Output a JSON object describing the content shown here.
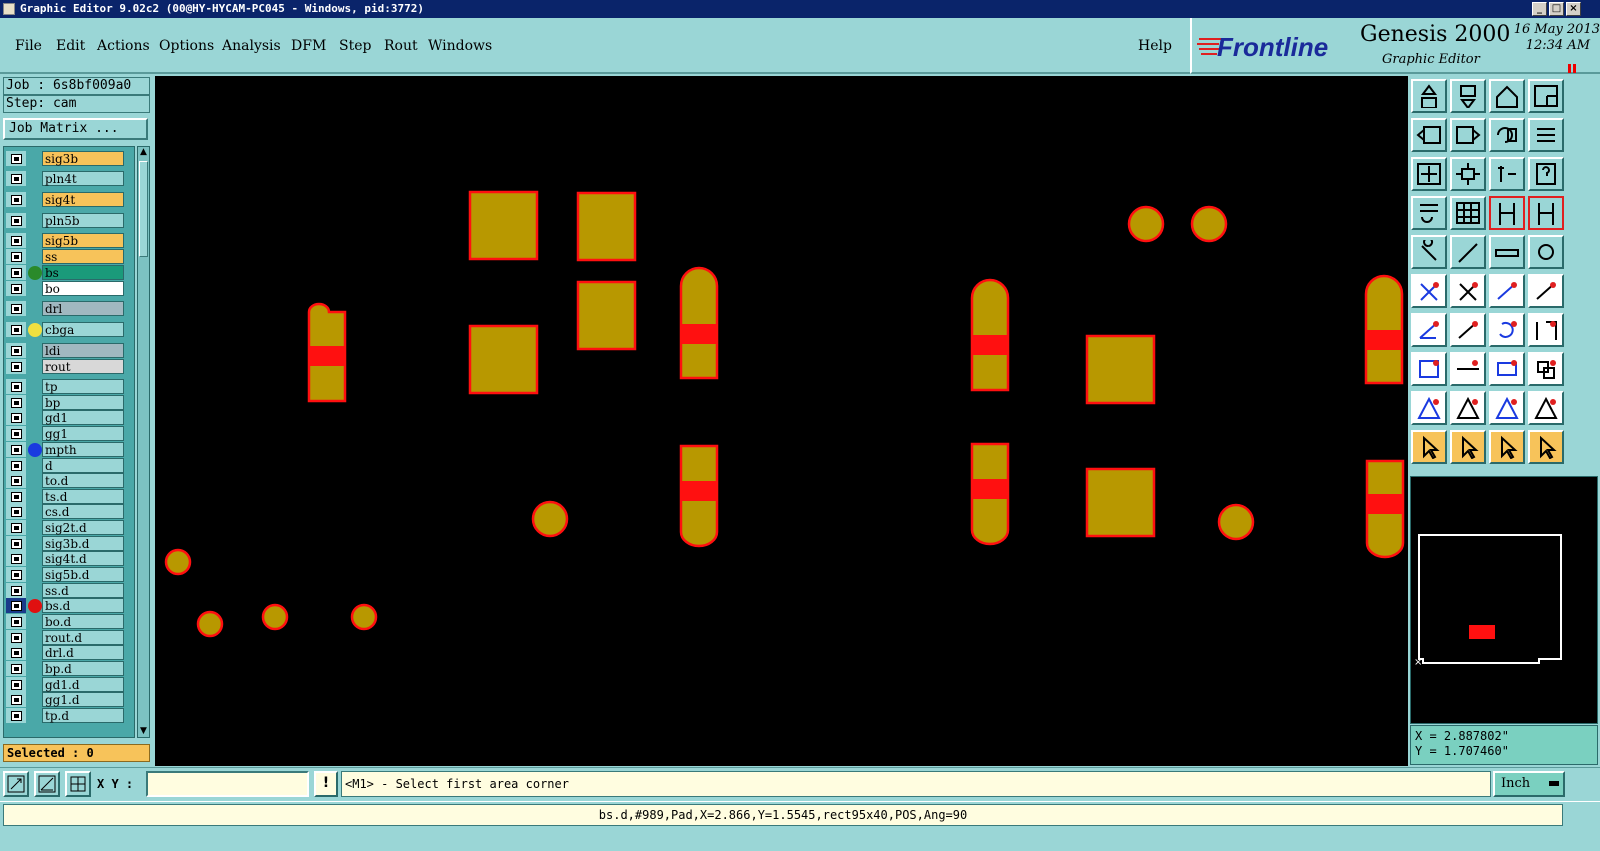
{
  "window": {
    "title": "Graphic Editor 9.02c2 (00@HY-HYCAM-PC045 - Windows, pid:3772)"
  },
  "menu": {
    "items": [
      "File",
      "Edit",
      "Actions",
      "Options",
      "Analysis",
      "DFM",
      "Step",
      "Rout",
      "Windows"
    ],
    "help": "Help"
  },
  "brand": {
    "logo_text": "Frontline",
    "product": "Genesis 2000",
    "subtitle": "Graphic Editor",
    "date": "16 May 2013",
    "time": "12:34 AM"
  },
  "job": {
    "job_label": "Job : 6s8bf009a0",
    "step_label": "Step: cam",
    "matrix_button": "Job Matrix ...",
    "selected": "Selected : 0"
  },
  "layers": [
    {
      "name": "sig3b",
      "bg": "#f7c35a",
      "dot": ""
    },
    {
      "name": "pln4t",
      "bg": "#9ad6d6",
      "dot": ""
    },
    {
      "name": "sig4t",
      "bg": "#f7c35a",
      "dot": ""
    },
    {
      "name": "pln5b",
      "bg": "#9ad6d6",
      "dot": ""
    },
    {
      "name": "sig5b",
      "bg": "#f7c35a",
      "dot": ""
    },
    {
      "name": "ss",
      "bg": "#f7c35a",
      "dot": ""
    },
    {
      "name": "bs",
      "bg": "#1a9a7a",
      "dot": "#2a8a2a"
    },
    {
      "name": "bo",
      "bg": "#ffffff",
      "dot": ""
    },
    {
      "name": "drl",
      "bg": "#a0b8c0",
      "dot": ""
    },
    {
      "name": "cbga",
      "bg": "#9ad6d6",
      "dot": "#f0e040"
    },
    {
      "name": "ldi",
      "bg": "#a0b8c0",
      "dot": ""
    },
    {
      "name": "rout",
      "bg": "#d8d8d8",
      "dot": ""
    },
    {
      "name": "tp",
      "bg": "#9ad6d6",
      "dot": ""
    },
    {
      "name": "bp",
      "bg": "#9ad6d6",
      "dot": ""
    },
    {
      "name": "gd1",
      "bg": "#9ad6d6",
      "dot": ""
    },
    {
      "name": "gg1",
      "bg": "#9ad6d6",
      "dot": ""
    },
    {
      "name": "mpth",
      "bg": "#9ad6d6",
      "dot": "#1a3ae0"
    },
    {
      "name": "d",
      "bg": "#9ad6d6",
      "dot": ""
    },
    {
      "name": "to.d",
      "bg": "#9ad6d6",
      "dot": ""
    },
    {
      "name": "ts.d",
      "bg": "#9ad6d6",
      "dot": ""
    },
    {
      "name": "cs.d",
      "bg": "#9ad6d6",
      "dot": ""
    },
    {
      "name": "sig2t.d",
      "bg": "#9ad6d6",
      "dot": ""
    },
    {
      "name": "sig3b.d",
      "bg": "#9ad6d6",
      "dot": ""
    },
    {
      "name": "sig4t.d",
      "bg": "#9ad6d6",
      "dot": ""
    },
    {
      "name": "sig5b.d",
      "bg": "#9ad6d6",
      "dot": ""
    },
    {
      "name": "ss.d",
      "bg": "#9ad6d6",
      "dot": ""
    },
    {
      "name": "bs.d",
      "bg": "#9ad6d6",
      "dot": "#e01010"
    },
    {
      "name": "bo.d",
      "bg": "#9ad6d6",
      "dot": ""
    },
    {
      "name": "rout.d",
      "bg": "#9ad6d6",
      "dot": ""
    },
    {
      "name": "drl.d",
      "bg": "#9ad6d6",
      "dot": ""
    },
    {
      "name": "bp.d",
      "bg": "#9ad6d6",
      "dot": ""
    },
    {
      "name": "gd1.d",
      "bg": "#9ad6d6",
      "dot": ""
    },
    {
      "name": "gg1.d",
      "bg": "#9ad6d6",
      "dot": ""
    },
    {
      "name": "tp.d",
      "bg": "#9ad6d6",
      "dot": ""
    }
  ],
  "coords": {
    "x": "X = 2.887802\"",
    "y": "Y = 1.707460\""
  },
  "bottom": {
    "xy_label": "X Y :",
    "xy_value": "",
    "warn": "!",
    "prompt": "<M1> - Select first area corner",
    "units": "Inch"
  },
  "status": "bs.d,#989,Pad,X=2.866,Y=1.5545,rect95x40,POS,Ang=90",
  "colors": {
    "pad_fill": "#b89800",
    "pad_outline": "#ff1010",
    "highlight": "#ff1010",
    "canvas_bg": "#000000",
    "ui_teal": "#9ad6d6",
    "ui_orange": "#f7c35a"
  }
}
